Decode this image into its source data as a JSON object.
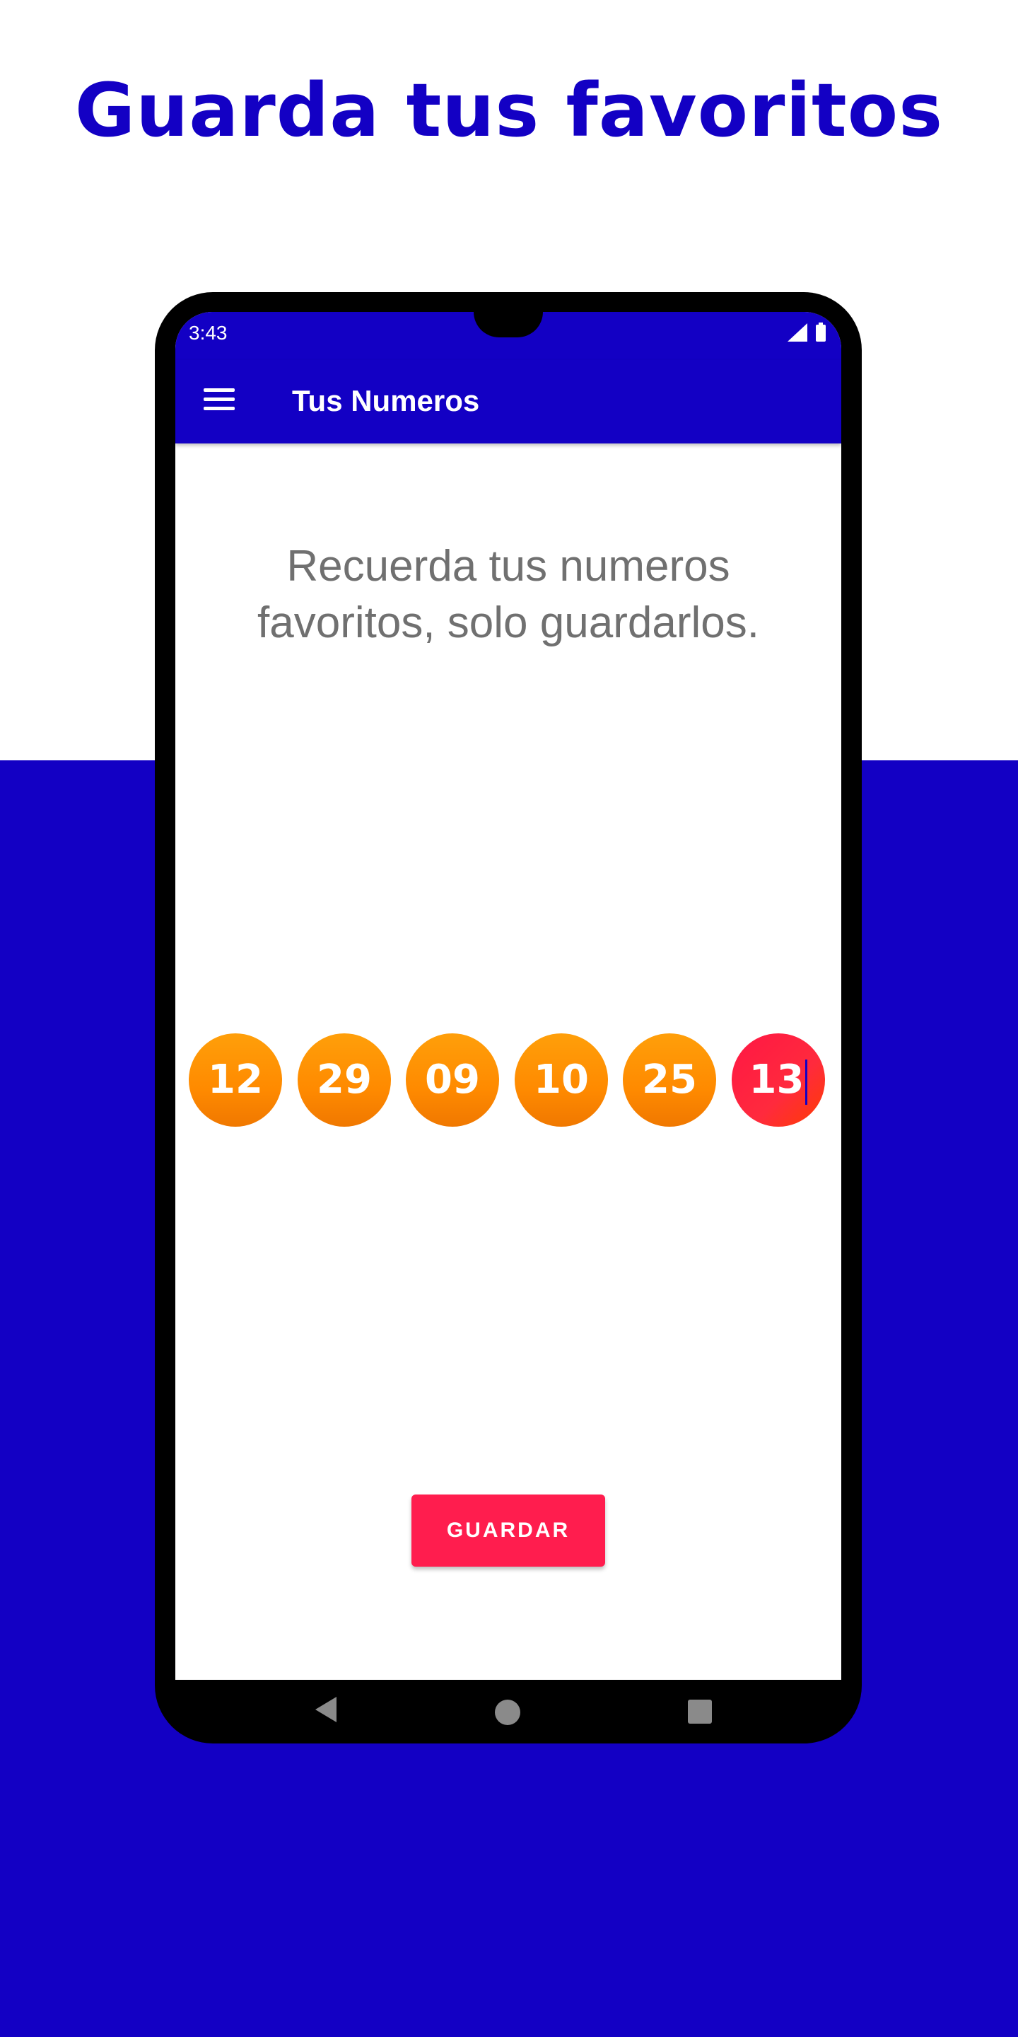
{
  "promo": {
    "title": "Guarda tus favoritos"
  },
  "status_bar": {
    "time": "3:43",
    "icons": [
      "signal-icon",
      "battery-icon"
    ]
  },
  "app_bar": {
    "menu_icon": "menu-icon",
    "title": "Tus Numeros"
  },
  "message": "Recuerda tus numeros favoritos, solo guardarlos.",
  "numbers": [
    {
      "value": "12",
      "color": "#ff8c00"
    },
    {
      "value": "29",
      "color": "#ff8c00"
    },
    {
      "value": "09",
      "color": "#ff8c00"
    },
    {
      "value": "10",
      "color": "#ff8c00"
    },
    {
      "value": "25",
      "color": "#ff8c00"
    },
    {
      "value": "13",
      "color": "#ff1744",
      "editing": true
    }
  ],
  "save_button": {
    "label": "GUARDAR"
  },
  "nav_bar": {
    "icons": [
      "back-icon",
      "home-icon",
      "recents-icon"
    ]
  },
  "colors": {
    "brand": "#1300c4",
    "accent": "#ff1d4e",
    "ball": "#ff8c00",
    "ball_selected": "#ff1744"
  }
}
